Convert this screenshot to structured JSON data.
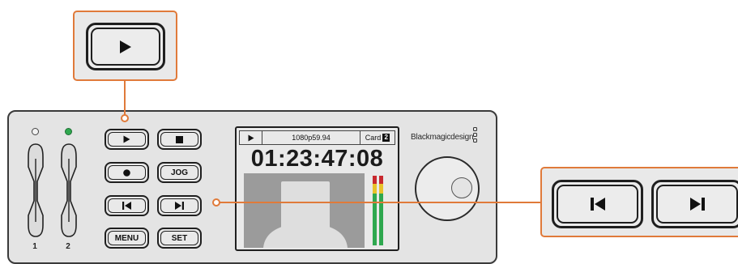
{
  "callouts": {
    "play_icon": "play-icon",
    "prev_icon": "skip-previous-icon",
    "next_icon": "skip-next-icon",
    "line_color": "#e07a3a"
  },
  "deck": {
    "slot_labels": [
      "1",
      "2"
    ],
    "buttons": {
      "play_icon": "play-icon",
      "stop_icon": "stop-icon",
      "record_icon": "record-icon",
      "jog_label": "JOG",
      "prev_icon": "skip-previous-icon",
      "next_icon": "skip-next-icon",
      "menu_label": "MENU",
      "set_label": "SET"
    },
    "lcd": {
      "status_icon": "play-icon",
      "format": "1080p59.94",
      "card_label": "Card",
      "card_number": "2",
      "timecode": "01:23:47:08"
    },
    "brand": "Blackmagicdesign"
  }
}
